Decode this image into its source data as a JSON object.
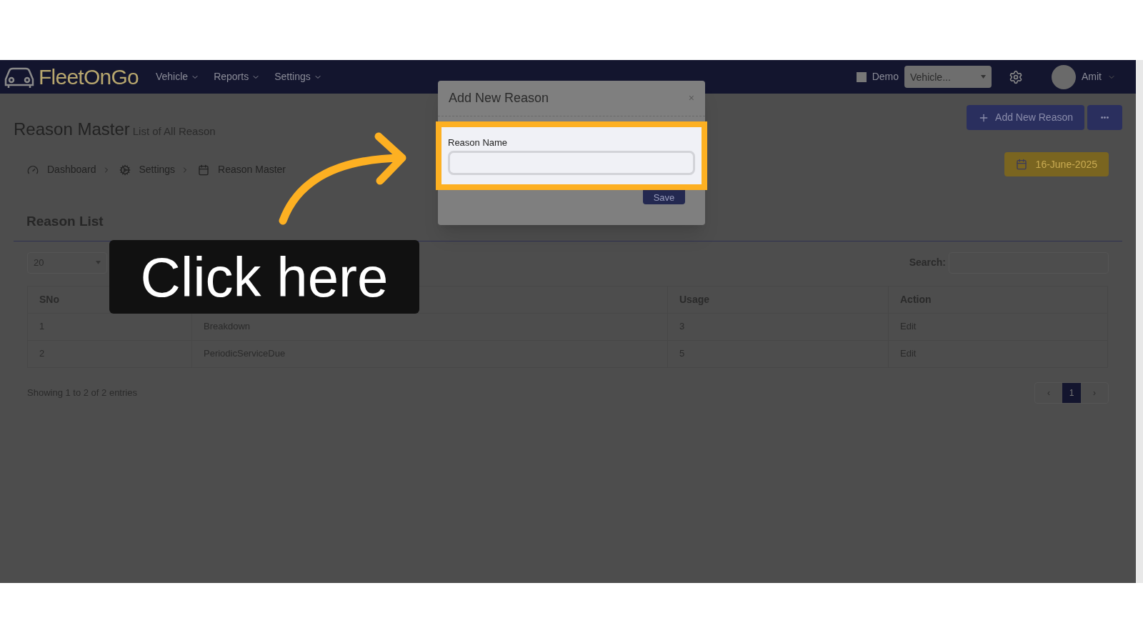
{
  "nav": {
    "logo": "FleetOnGo",
    "menus": [
      "Vehicle",
      "Reports",
      "Settings"
    ],
    "demo": {
      "label": "Demo",
      "checked": false
    },
    "vehicle_select": {
      "placeholder": "Vehicle..."
    },
    "user": "Amit"
  },
  "header": {
    "title": "Reason Master",
    "subtitle": "List of All Reason",
    "add_button": "Add New Reason",
    "more_button": "•••",
    "date": "16-June-2025"
  },
  "breadcrumb": [
    {
      "label": "Dashboard",
      "kind": "dashboard"
    },
    {
      "label": "Settings",
      "kind": "settings"
    },
    {
      "label": "Reason Master",
      "kind": "calendar"
    }
  ],
  "list": {
    "title": "Reason List",
    "page_size": "20",
    "search_label": "Search:",
    "columns": [
      "SNo",
      "",
      "Usage",
      "Action"
    ],
    "rows": [
      [
        "1",
        "Breakdown",
        "3",
        "Edit"
      ],
      [
        "2",
        "PeriodicServiceDue",
        "5",
        "Edit"
      ]
    ],
    "footer": "Showing 1 to 2 of 2 entries",
    "pagination": {
      "prev": "‹",
      "next": "›",
      "pages": [
        {
          "label": "1",
          "selected": true
        }
      ]
    }
  },
  "modal": {
    "title": "Add New Reason",
    "close": "×",
    "field_label": "Reason Name",
    "save": "Save"
  },
  "callout": {
    "text": "Click here"
  }
}
